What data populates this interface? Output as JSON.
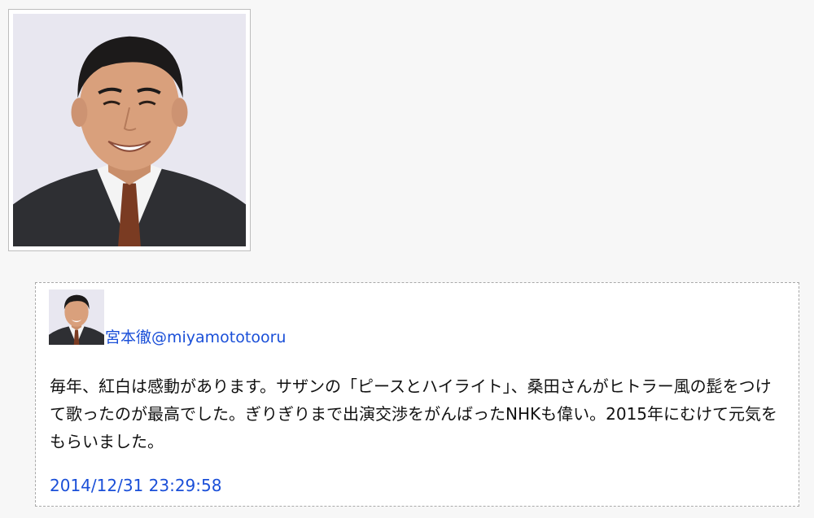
{
  "profile": {
    "photo_icon": "person-portrait"
  },
  "tweet": {
    "avatar_icon": "person-portrait",
    "author": "宮本徹@miyamototooru",
    "text": "毎年、紅白は感動があります。サザンの「ピースとハイライト」、桑田さんがヒトラー風の髭をつけて歌ったのが最高でした。ぎりぎりまで出演交渉をがんばったNHKも偉い。2015年にむけて元気をもらいました。",
    "timestamp": "2014/12/31 23:29:58"
  },
  "colors": {
    "link": "#1a4fd8",
    "text": "#111111",
    "page_background": "#f7f7f7",
    "card_border": "#a9a9a9"
  }
}
